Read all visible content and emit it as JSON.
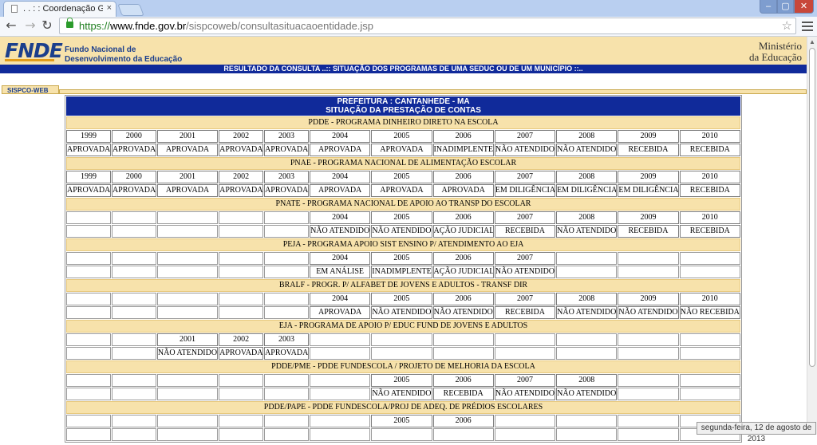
{
  "browser": {
    "tab_title": ". . : : Coordenação Geral D",
    "tab_close": "×",
    "window_min": "–",
    "window_max": "▢",
    "window_close": "✕",
    "url_scheme": "https://",
    "url_host": "www.fnde.gov.br",
    "url_path": "/sispcoweb/consultasituacaoentidade.jsp",
    "back": "←",
    "forward": "→",
    "reload": "↻",
    "star": "☆"
  },
  "header": {
    "logo": "FNDE",
    "org_line1": "Fundo Nacional de",
    "org_line2": "Desenvolvimento da Educação",
    "ministry_line1": "Ministério",
    "ministry_line2": "da Educação",
    "result_bar": "RESULTADO DA CONSULTA ..:: SITUAÇÃO DOS PROGRAMAS DE UMA SEDUC OU DE UM MUNICÍPIO ::..",
    "system_tab": "SISPCO-WEB"
  },
  "report": {
    "title_line1": "PREFEITURA : CANTANHEDE - MA",
    "title_line2": "SITUAÇÃO DA PRESTAÇÃO DE CONTAS",
    "programs": [
      {
        "name": "PDDE - PROGRAMA DINHEIRO DIRETO NA ESCOLA",
        "years": [
          "1999",
          "2000",
          "2001",
          "2002",
          "2003",
          "2004",
          "2005",
          "2006",
          "2007",
          "2008",
          "2009",
          "2010"
        ],
        "status": [
          "APROVADA",
          "APROVADA",
          "APROVADA",
          "APROVADA",
          "APROVADA",
          "APROVADA",
          "APROVADA",
          "INADIMPLENTE",
          "NÃO ATENDIDO",
          "NÃO ATENDIDO",
          "RECEBIDA",
          "RECEBIDA"
        ]
      },
      {
        "name": "PNAE - PROGRAMA NACIONAL DE ALIMENTAÇÃO ESCOLAR",
        "years": [
          "1999",
          "2000",
          "2001",
          "2002",
          "2003",
          "2004",
          "2005",
          "2006",
          "2007",
          "2008",
          "2009",
          "2010"
        ],
        "status": [
          "APROVADA",
          "APROVADA",
          "APROVADA",
          "APROVADA",
          "APROVADA",
          "APROVADA",
          "APROVADA",
          "APROVADA",
          "EM DILIGÊNCIA",
          "EM DILIGÊNCIA",
          "EM DILIGÊNCIA",
          "RECEBIDA"
        ]
      },
      {
        "name": "PNATE - PROGRAMA NACIONAL DE APOIO AO TRANSP DO ESCOLAR",
        "years": [
          "",
          "",
          "",
          "",
          "",
          "2004",
          "2005",
          "2006",
          "2007",
          "2008",
          "2009",
          "2010"
        ],
        "status": [
          "",
          "",
          "",
          "",
          "",
          "NÃO ATENDIDO",
          "NÃO ATENDIDO",
          "AÇÃO JUDICIAL",
          "RECEBIDA",
          "NÃO ATENDIDO",
          "RECEBIDA",
          "RECEBIDA"
        ]
      },
      {
        "name": "PEJA - PROGRAMA APOIO SIST ENSINO P/ ATENDIMENTO AO EJA",
        "years": [
          "",
          "",
          "",
          "",
          "",
          "2004",
          "2005",
          "2006",
          "2007",
          "",
          "",
          ""
        ],
        "status": [
          "",
          "",
          "",
          "",
          "",
          "EM ANÁLISE",
          "INADIMPLENTE",
          "AÇÃO JUDICIAL",
          "NÃO ATENDIDO",
          "",
          "",
          ""
        ]
      },
      {
        "name": "BRALF - PROGR. P/ ALFABET DE JOVENS E ADULTOS - TRANSF DIR",
        "years": [
          "",
          "",
          "",
          "",
          "",
          "2004",
          "2005",
          "2006",
          "2007",
          "2008",
          "2009",
          "2010"
        ],
        "status": [
          "",
          "",
          "",
          "",
          "",
          "APROVADA",
          "NÃO ATENDIDO",
          "NÃO ATENDIDO",
          "RECEBIDA",
          "NÃO ATENDIDO",
          "NÃO ATENDIDO",
          "NÃO RECEBIDA"
        ]
      },
      {
        "name": "EJA - PROGRAMA DE APOIO P/ EDUC FUND DE JOVENS E ADULTOS",
        "years": [
          "",
          "",
          "2001",
          "2002",
          "2003",
          "",
          "",
          "",
          "",
          "",
          "",
          ""
        ],
        "status": [
          "",
          "",
          "NÃO ATENDIDO",
          "APROVADA",
          "APROVADA",
          "",
          "",
          "",
          "",
          "",
          "",
          ""
        ]
      },
      {
        "name": "PDDE/PME - PDDE FUNDESCOLA / PROJETO DE MELHORIA DA ESCOLA",
        "years": [
          "",
          "",
          "",
          "",
          "",
          "",
          "2005",
          "2006",
          "2007",
          "2008",
          "",
          ""
        ],
        "status": [
          "",
          "",
          "",
          "",
          "",
          "",
          "NÃO ATENDIDO",
          "RECEBIDA",
          "NÃO ATENDIDO",
          "NÃO ATENDIDO",
          "",
          ""
        ]
      },
      {
        "name": "PDDE/PAPE - PDDE FUNDESCOLA/PROJ DE ADEQ. DE PRÉDIOS ESCOLARES",
        "years": [
          "",
          "",
          "",
          "",
          "",
          "",
          "2005",
          "2006",
          "",
          "",
          "",
          ""
        ],
        "status": [
          "",
          "",
          "",
          "",
          "",
          "",
          "",
          "",
          "",
          "",
          "",
          ""
        ]
      }
    ]
  },
  "footer": {
    "date": "segunda-feira, 12 de agosto de 2013"
  },
  "colors": {
    "header_bg": "#f7e2ab",
    "navy": "#102a9a",
    "logo_blue": "#1c3f8c",
    "logo_accent": "#e39b18"
  }
}
